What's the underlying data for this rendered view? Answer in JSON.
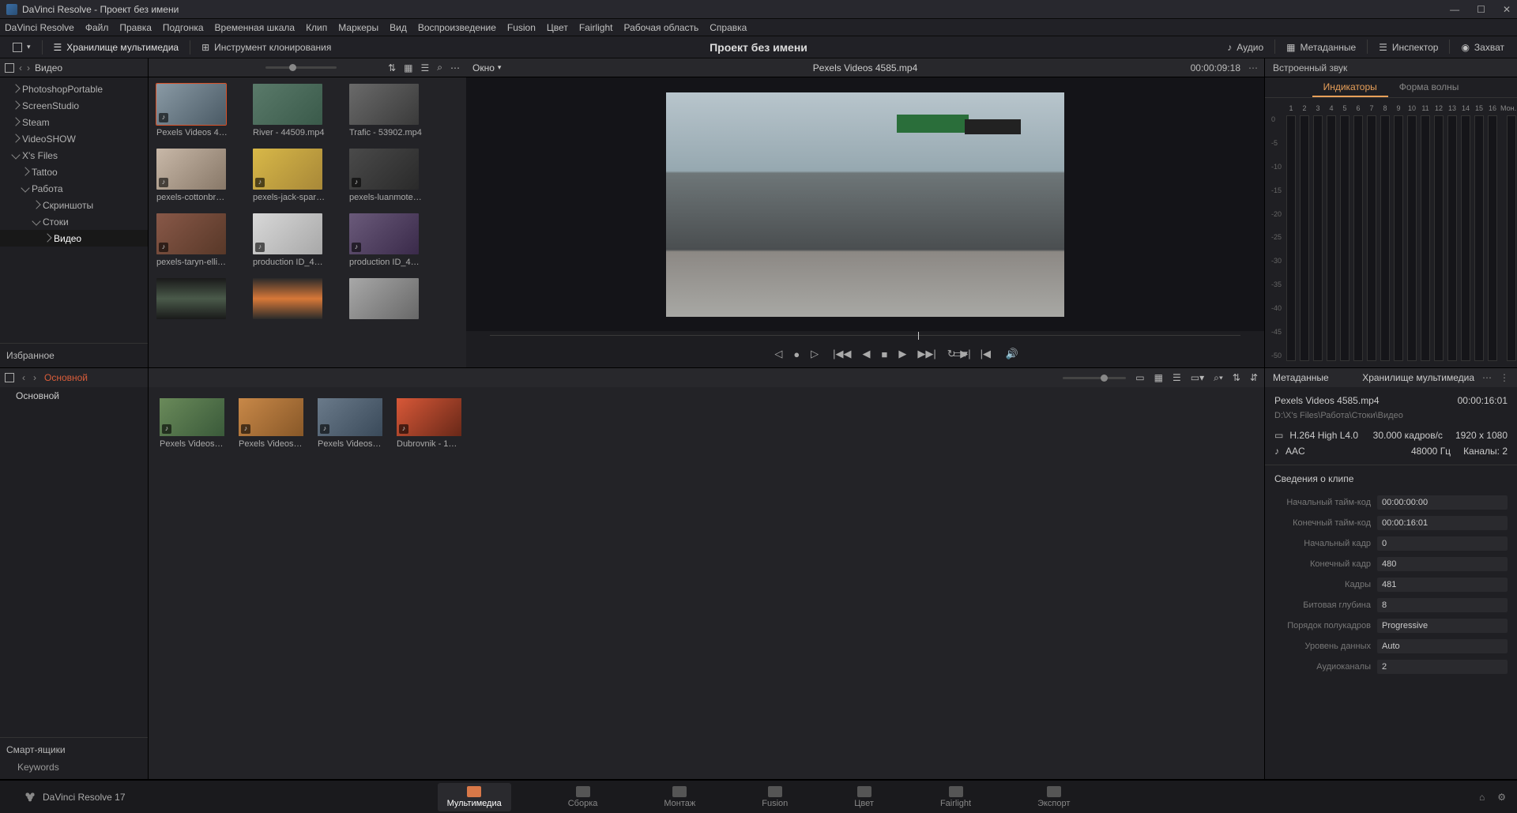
{
  "window": {
    "title": "DaVinci Resolve - Проект без имени"
  },
  "menubar": [
    "DaVinci Resolve",
    "Файл",
    "Правка",
    "Подгонка",
    "Временная шкала",
    "Клип",
    "Маркеры",
    "Вид",
    "Воспроизведение",
    "Fusion",
    "Цвет",
    "Fairlight",
    "Рабочая область",
    "Справка"
  ],
  "toolbar": {
    "media_storage": "Хранилище мультимедиа",
    "clone_tool": "Инструмент клонирования",
    "project_title": "Проект без имени",
    "audio": "Аудио",
    "metadata": "Метаданные",
    "inspector": "Инспектор",
    "capture": "Захват"
  },
  "folders": {
    "header": "Видео",
    "items": [
      {
        "label": "PhotoshopPortable",
        "lvl": 0,
        "exp": false
      },
      {
        "label": "ScreenStudio",
        "lvl": 0,
        "exp": false
      },
      {
        "label": "Steam",
        "lvl": 0,
        "exp": false
      },
      {
        "label": "VideoSHOW",
        "lvl": 0,
        "exp": false
      },
      {
        "label": "X's Files",
        "lvl": 0,
        "exp": true
      },
      {
        "label": "Tattoo",
        "lvl": 1,
        "exp": false
      },
      {
        "label": "Работа",
        "lvl": 1,
        "exp": true
      },
      {
        "label": "Скриншоты",
        "lvl": 2,
        "exp": false
      },
      {
        "label": "Стоки",
        "lvl": 2,
        "exp": true
      },
      {
        "label": "Видео",
        "lvl": 3,
        "exp": false,
        "sel": true
      }
    ],
    "favorites": "Избранное"
  },
  "media_browser": {
    "clips": [
      {
        "label": "Pexels Videos 4585...",
        "sel": true,
        "aud": true
      },
      {
        "label": "River - 44509.mp4",
        "aud": false
      },
      {
        "label": "Trafic - 53902.mp4",
        "aud": false
      },
      {
        "label": "pexels-cottonbro-54...",
        "aud": true
      },
      {
        "label": "pexels-jack-sparrow-...",
        "aud": true
      },
      {
        "label": "pexels-luanmote-66...",
        "aud": true
      },
      {
        "label": "pexels-taryn-elliott-5...",
        "aud": true
      },
      {
        "label": "production ID_42649...",
        "aud": true
      },
      {
        "label": "production ID_43407...",
        "aud": true
      },
      {
        "label": "",
        "aud": false
      },
      {
        "label": "",
        "aud": false
      },
      {
        "label": "",
        "aud": false
      }
    ]
  },
  "viewer": {
    "window_dd": "Окно",
    "filename": "Pexels Videos 4585.mp4",
    "timecode": "00:00:09:18"
  },
  "meters": {
    "header": "Встроенный звук",
    "tab_indicators": "Индикаторы",
    "tab_waveform": "Форма волны",
    "channels": [
      "1",
      "2",
      "3",
      "4",
      "5",
      "6",
      "7",
      "8",
      "9",
      "10",
      "11",
      "12",
      "13",
      "14",
      "15",
      "16"
    ],
    "mon": "Мон...инг",
    "scale": [
      "0",
      "-5",
      "-10",
      "-15",
      "-20",
      "-25",
      "-30",
      "-35",
      "-40",
      "-45",
      "-50"
    ]
  },
  "bins": {
    "header": "Основной",
    "master": "Основной",
    "smart": "Смарт-ящики",
    "keywords": "Keywords"
  },
  "media_pool": {
    "clips": [
      {
        "label": "Pexels Videos 141...",
        "aud": true
      },
      {
        "label": "Pexels Videos 139...",
        "aud": true
      },
      {
        "label": "Pexels Videos 458...",
        "aud": true
      },
      {
        "label": "Dubrovnik - 1286...",
        "aud": true
      }
    ]
  },
  "metadata": {
    "header": "Метаданные",
    "header_right": "Хранилище мультимедиа",
    "name": "Pexels Videos 4585.mp4",
    "dur": "00:00:16:01",
    "path": "D:\\X's Files\\Работа\\Стоки\\Видео",
    "codec": "H.264 High L4.0",
    "fps": "30.000 кадров/с",
    "res": "1920 x 1080",
    "acodec": "AAC",
    "arate": "48000 Гц",
    "ach": "Каналы: 2",
    "clip_details": "Сведения о клипе",
    "fields": [
      {
        "l": "Начальный тайм-код",
        "v": "00:00:00:00"
      },
      {
        "l": "Конечный тайм-код",
        "v": "00:00:16:01"
      },
      {
        "l": "Начальный кадр",
        "v": "0"
      },
      {
        "l": "Конечный кадр",
        "v": "480"
      },
      {
        "l": "Кадры",
        "v": "481"
      },
      {
        "l": "Битовая глубина",
        "v": "8"
      },
      {
        "l": "Порядок полукадров",
        "v": "Progressive"
      },
      {
        "l": "Уровень данных",
        "v": "Auto"
      },
      {
        "l": "Аудиоканалы",
        "v": "2"
      }
    ]
  },
  "pages": {
    "brand": "DaVinci Resolve 17",
    "items": [
      "Мультимедиа",
      "Сборка",
      "Монтаж",
      "Fusion",
      "Цвет",
      "Fairlight",
      "Экспорт"
    ]
  }
}
